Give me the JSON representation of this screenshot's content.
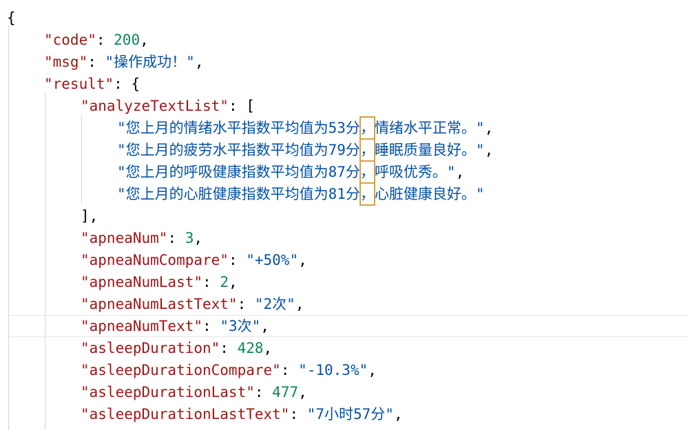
{
  "json": {
    "open_brace": "{",
    "code_key": "\"code\"",
    "code_val": "200",
    "msg_key": "\"msg\"",
    "msg_val": "\"操作成功！\"",
    "result_key": "\"result\"",
    "result_open": "{",
    "analyze_key": "\"analyzeTextList\"",
    "analyze_open": "[",
    "analyze_items": [
      {
        "pre": "\"您上月的情绪水平指数平均值为53分",
        "comma": "，",
        "post": "情绪水平正常。\"",
        "sep": ","
      },
      {
        "pre": "\"您上月的疲劳水平指数平均值为79分",
        "comma": "，",
        "post": "睡眠质量良好。\"",
        "sep": ","
      },
      {
        "pre": "\"您上月的呼吸健康指数平均值为87分",
        "comma": "，",
        "post": "呼吸优秀。\"",
        "sep": ","
      },
      {
        "pre": "\"您上月的心脏健康指数平均值为81分",
        "comma": "，",
        "post": "心脏健康良好。\"",
        "sep": ""
      }
    ],
    "analyze_close": "],",
    "fields": [
      {
        "key": "\"apneaNum\"",
        "val": "3",
        "type": "number"
      },
      {
        "key": "\"apneaNumCompare\"",
        "val": "\"+50%\"",
        "type": "string"
      },
      {
        "key": "\"apneaNumLast\"",
        "val": "2",
        "type": "number"
      },
      {
        "key": "\"apneaNumLastText\"",
        "val": "\"2次\"",
        "type": "string"
      },
      {
        "key": "\"apneaNumText\"",
        "val": "\"3次\"",
        "type": "string"
      },
      {
        "key": "\"asleepDuration\"",
        "val": "428",
        "type": "number"
      },
      {
        "key": "\"asleepDurationCompare\"",
        "val": "\"-10.3%\"",
        "type": "string"
      },
      {
        "key": "\"asleepDurationLast\"",
        "val": "477",
        "type": "number"
      },
      {
        "key": "\"asleepDurationLastText\"",
        "val": "\"7小时57分\"",
        "type": "string"
      }
    ]
  },
  "colors": {
    "key": "#a31515",
    "string": "#0451a5",
    "number": "#098658",
    "highlight": "#d4a23a"
  }
}
